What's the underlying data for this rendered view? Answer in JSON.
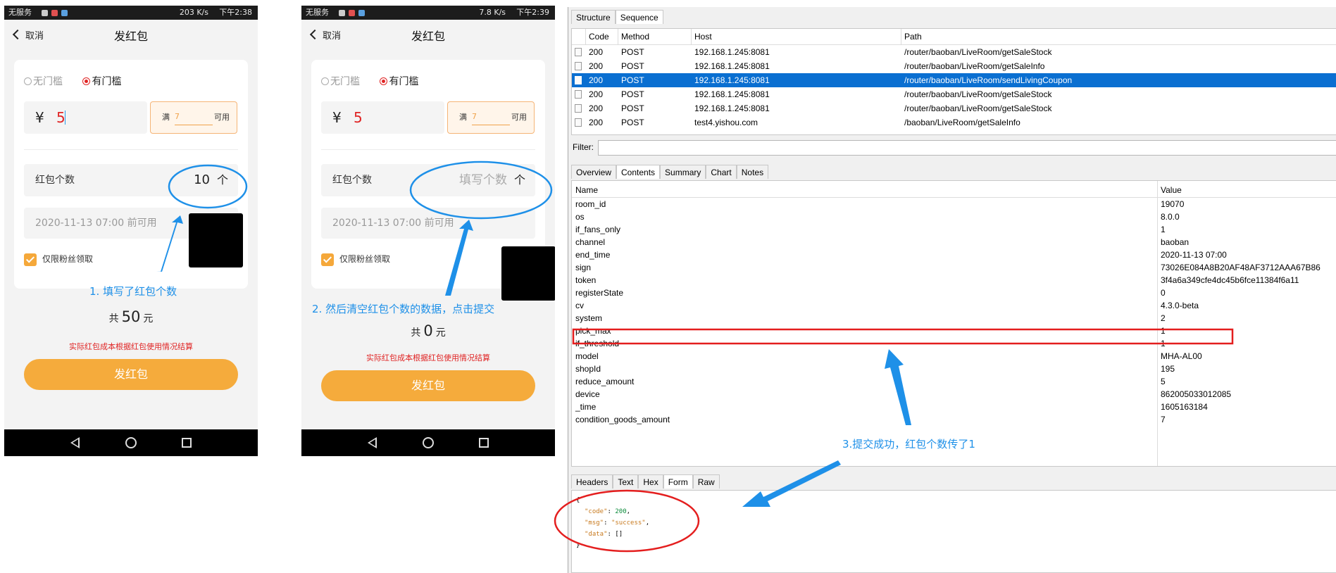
{
  "phone1": {
    "status": {
      "carrier": "无服务",
      "net": "203 K/s",
      "time": "下午2:38"
    },
    "back": "取消",
    "title": "发红包",
    "radio_none": "无门槛",
    "radio_threshold": "有门槛",
    "currency": "¥",
    "amount": "5",
    "man": "满",
    "threshold_value": "7",
    "avail": "可用",
    "count_label": "红包个数",
    "count_value": "10",
    "up_arrow": "个",
    "date": "2020-11-13 07:00 前可用",
    "fans_only": "仅限粉丝领取",
    "total_prefix": "共",
    "total_value": "50",
    "total_unit": "元",
    "note": "实际红包成本根据红包使用情况结算",
    "send": "发红包"
  },
  "phone2": {
    "status": {
      "carrier": "无服务",
      "net": "7.8 K/s",
      "time": "下午2:39"
    },
    "back": "取消",
    "title": "发红包",
    "radio_none": "无门槛",
    "radio_threshold": "有门槛",
    "currency": "¥",
    "amount": "5",
    "man": "满",
    "threshold_value": "7",
    "avail": "可用",
    "count_label": "红包个数",
    "count_placeholder": "填写个数",
    "up_arrow": "个",
    "date": "2020-11-13 07:00 前可用",
    "fans_only": "仅限粉丝领取",
    "total_prefix": "共",
    "total_value": "0",
    "total_unit": "元",
    "note": "实际红包成本根据红包使用情况结算",
    "send": "发红包"
  },
  "annotations": {
    "a1": "1. 填写了红包个数",
    "a2": "2. 然后清空红包个数的数据，点击提交",
    "a3": "3.提交成功，红包个数传了1"
  },
  "colors": {
    "annotation": "#1e90e8",
    "highlight": "#e41e1e",
    "accent": "#f5ab3c",
    "selection": "#0a6fd1"
  },
  "charles": {
    "top_tabs": [
      "Structure",
      "Sequence"
    ],
    "columns": [
      "Code",
      "Method",
      "Host",
      "Path"
    ],
    "rows": [
      {
        "code": "200",
        "method": "POST",
        "host": "192.168.1.245:8081",
        "path": "/router/baoban/LiveRoom/getSaleStock"
      },
      {
        "code": "200",
        "method": "POST",
        "host": "192.168.1.245:8081",
        "path": "/router/baoban/LiveRoom/getSaleInfo"
      },
      {
        "code": "200",
        "method": "POST",
        "host": "192.168.1.245:8081",
        "path": "/router/baoban/LiveRoom/sendLivingCoupon"
      },
      {
        "code": "200",
        "method": "POST",
        "host": "192.168.1.245:8081",
        "path": "/router/baoban/LiveRoom/getSaleStock"
      },
      {
        "code": "200",
        "method": "POST",
        "host": "192.168.1.245:8081",
        "path": "/router/baoban/LiveRoom/getSaleStock"
      },
      {
        "code": "200",
        "method": "POST",
        "host": "test4.yishou.com",
        "path": "/baoban/LiveRoom/getSaleInfo"
      }
    ],
    "selected_row": 2,
    "filter_label": "Filter:",
    "filter_value": "",
    "detail_tabs": [
      "Overview",
      "Contents",
      "Summary",
      "Chart",
      "Notes"
    ],
    "active_detail_tab": "Contents",
    "kv_headers": [
      "Name",
      "Value"
    ],
    "kv": [
      {
        "k": "room_id",
        "v": "19070"
      },
      {
        "k": "os",
        "v": "8.0.0"
      },
      {
        "k": "if_fans_only",
        "v": "1"
      },
      {
        "k": "channel",
        "v": "baoban"
      },
      {
        "k": "end_time",
        "v": "2020-11-13 07:00"
      },
      {
        "k": "sign",
        "v": "73026E084A8B20AF48AF3712AAA67B86"
      },
      {
        "k": "token",
        "v": "3f4a6a349cfe4dc45b6fce11384f6a11"
      },
      {
        "k": "registerState",
        "v": "0"
      },
      {
        "k": "cv",
        "v": "4.3.0-beta"
      },
      {
        "k": "system",
        "v": "2"
      },
      {
        "k": "pick_max",
        "v": "1"
      },
      {
        "k": "if_threshold",
        "v": "1"
      },
      {
        "k": "model",
        "v": "MHA-AL00"
      },
      {
        "k": "shopId",
        "v": "195"
      },
      {
        "k": "reduce_amount",
        "v": "5"
      },
      {
        "k": "device",
        "v": "862005033012085"
      },
      {
        "k": "_time",
        "v": "1605163184"
      },
      {
        "k": "condition_goods_amount",
        "v": "7"
      }
    ],
    "bottom_tabs": [
      "Headers",
      "Text",
      "Hex",
      "Form",
      "Raw"
    ],
    "active_bottom_tab": "Form",
    "response": {
      "open": "{",
      "code_key": "\"code\"",
      "code_val": "200",
      "msg_key": "\"msg\"",
      "msg_val": "\"success\"",
      "data_key": "\"data\"",
      "data_val": "[]",
      "close": "}"
    }
  }
}
